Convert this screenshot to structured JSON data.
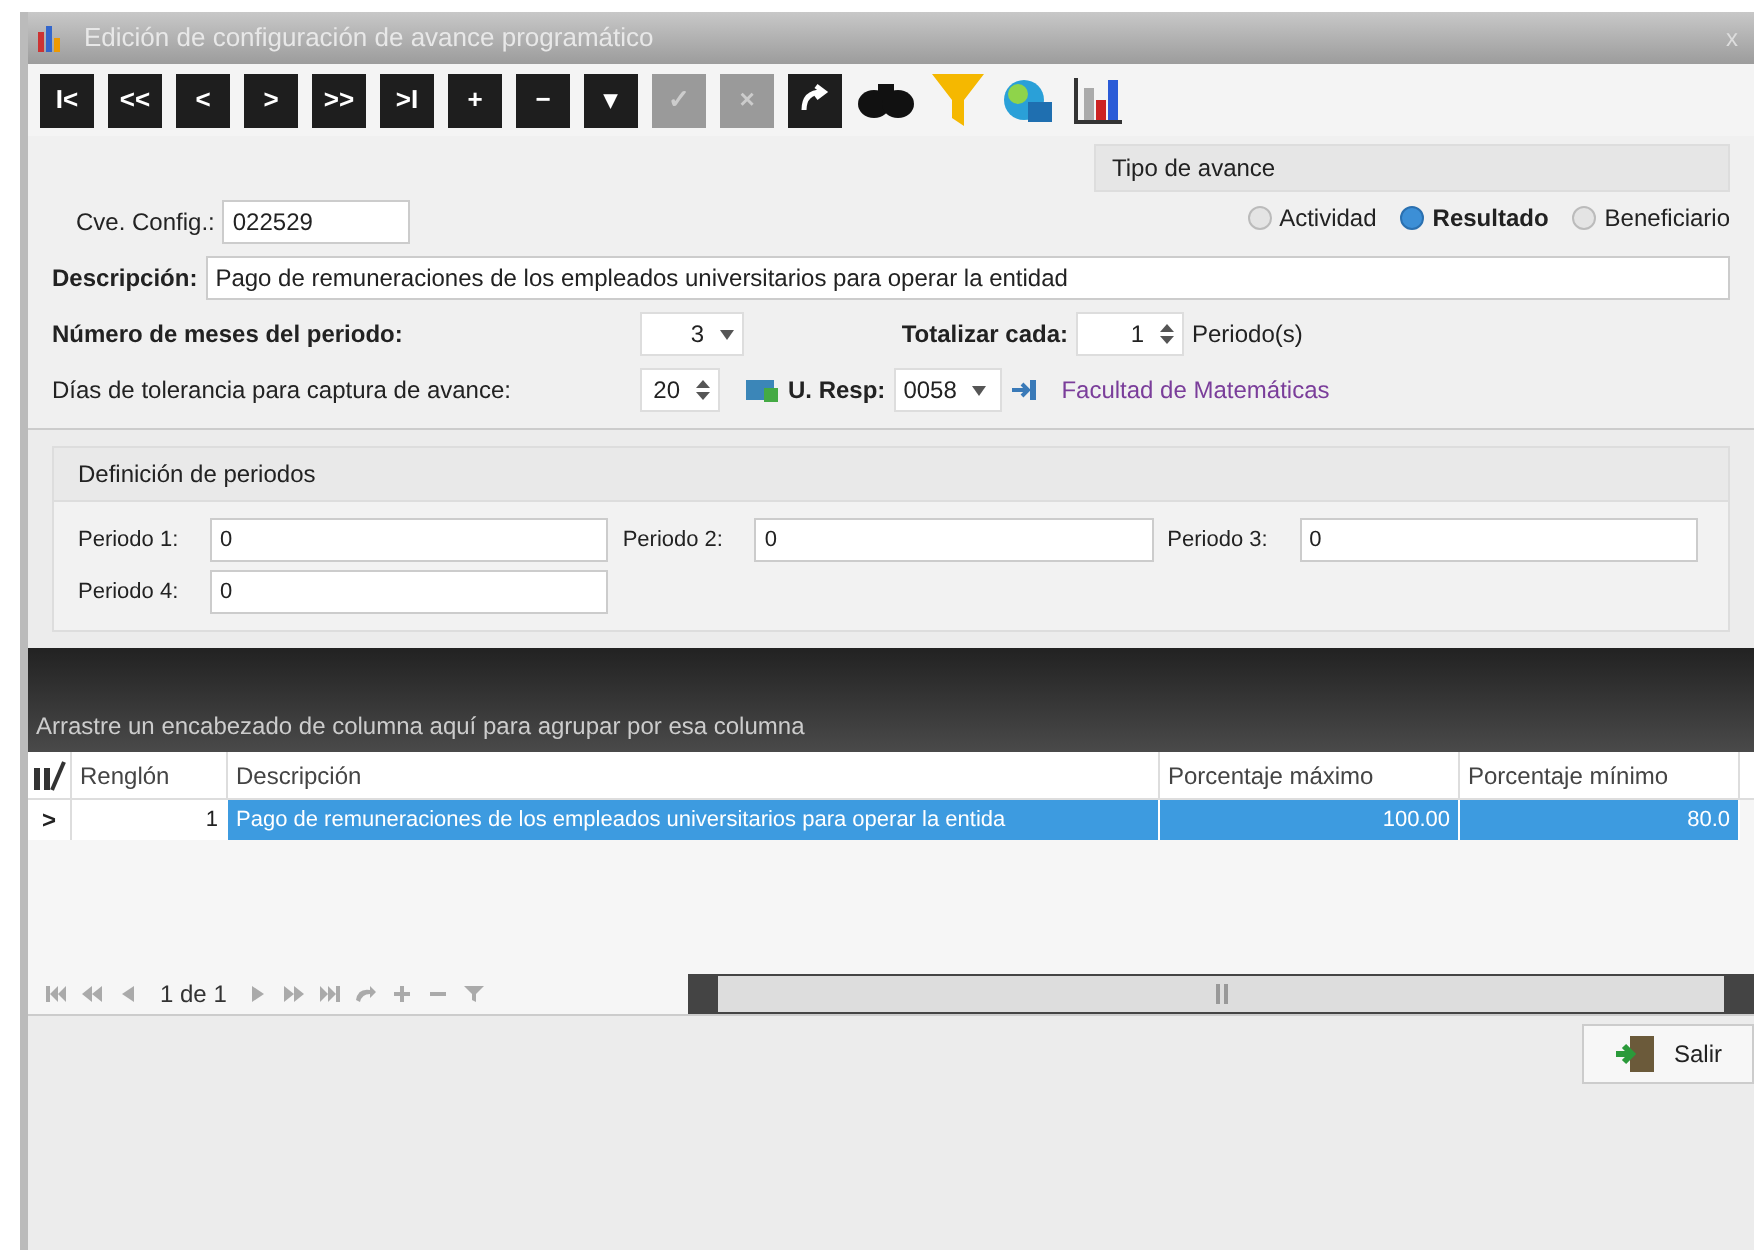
{
  "window": {
    "title": "Edición de configuración de avance programático",
    "close": "x"
  },
  "toolbar": {
    "buttons": [
      {
        "label": "I<",
        "disabled": false
      },
      {
        "label": "<<",
        "disabled": false
      },
      {
        "label": "<",
        "disabled": false
      },
      {
        "label": ">",
        "disabled": false
      },
      {
        "label": ">>",
        "disabled": false
      },
      {
        "label": ">I",
        "disabled": false
      },
      {
        "label": "+",
        "disabled": false
      },
      {
        "label": "−",
        "disabled": false
      },
      {
        "label": "▾",
        "disabled": false
      },
      {
        "label": "✓",
        "disabled": true
      },
      {
        "label": "×",
        "disabled": true
      }
    ],
    "icons": [
      {
        "kind": "redo"
      },
      {
        "kind": "binoculars"
      },
      {
        "kind": "filter"
      },
      {
        "kind": "database"
      },
      {
        "kind": "chart"
      }
    ]
  },
  "form": {
    "cve_label": "Cve. Config.:",
    "cve_value": "022529",
    "tipo": {
      "title": "Tipo de avance",
      "options": [
        {
          "label": "Actividad",
          "selected": false
        },
        {
          "label": "Resultado",
          "selected": true
        },
        {
          "label": "Beneficiario",
          "selected": false
        }
      ]
    },
    "descripcion_label": "Descripción:",
    "descripcion_value": "Pago de remuneraciones de los empleados universitarios para operar la entidad",
    "meses_label": "Número de meses del periodo:",
    "meses_value": "3",
    "totalizar_label": "Totalizar cada:",
    "totalizar_value": "1",
    "totalizar_unit": "Periodo(s)",
    "dias_label": "Días de tolerancia para captura de avance:",
    "dias_value": "20",
    "uresp_label": "U. Resp:",
    "uresp_value": "0058",
    "uresp_name": "Facultad de Matemáticas"
  },
  "periodos": {
    "title": "Definición de periodos",
    "items": [
      {
        "label": "Periodo 1:",
        "value": "0"
      },
      {
        "label": "Periodo 2:",
        "value": "0"
      },
      {
        "label": "Periodo 3:",
        "value": "0"
      },
      {
        "label": "Periodo 4:",
        "value": "0"
      }
    ]
  },
  "grid": {
    "group_hint": "Arrastre un encabezado de columna aquí para agrupar por esa columna",
    "columns": [
      "Renglón",
      "Descripción",
      "Porcentaje máximo",
      "Porcentaje mínimo"
    ],
    "rows": [
      {
        "indicator": ">",
        "selected": true,
        "cells": [
          "1",
          "Pago de remuneraciones de los empleados universitarios para operar la entida",
          "100.00",
          "80.0"
        ]
      }
    ],
    "pager": "1 de 1"
  },
  "buttons": [
    {
      "label": "Salir"
    }
  ]
}
